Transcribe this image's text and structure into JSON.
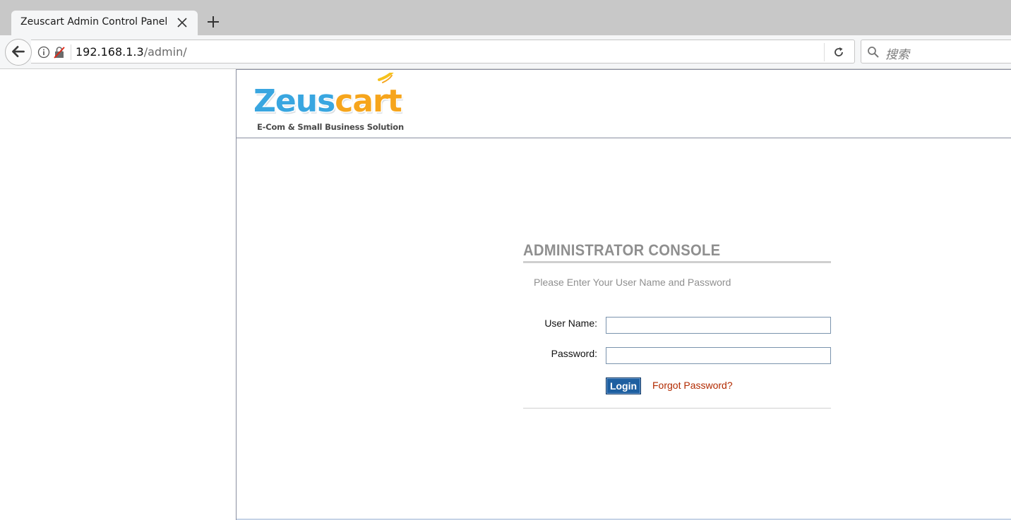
{
  "browser": {
    "tab_title": "Zeuscart Admin Control Panel",
    "url_host": "192.168.1.3",
    "url_path": "/admin/",
    "search_placeholder": "搜索",
    "icons": {
      "tab_close": "close-icon",
      "new_tab": "plus-icon",
      "back": "back-arrow-icon",
      "site_info": "info-icon",
      "insecure": "insecure-lock-icon",
      "reload": "reload-icon",
      "search": "search-icon"
    }
  },
  "logo": {
    "brand_part1": "Zeus",
    "brand_part2": "cart",
    "tagline": "E-Com & Small Business Solution",
    "colors": {
      "blue": "#39a6e0",
      "orange": "#f6a51c"
    }
  },
  "login": {
    "title": "ADMINISTRATOR CONSOLE",
    "subtitle": "Please Enter Your User Name and Password",
    "username_label": "User Name:",
    "username_value": "",
    "password_label": "Password:",
    "password_value": "",
    "login_button": "Login",
    "forgot_link": "Forgot Password?",
    "colors": {
      "button": "#1e5fa0",
      "link": "#b22a00",
      "title": "#8f8f8f"
    }
  }
}
